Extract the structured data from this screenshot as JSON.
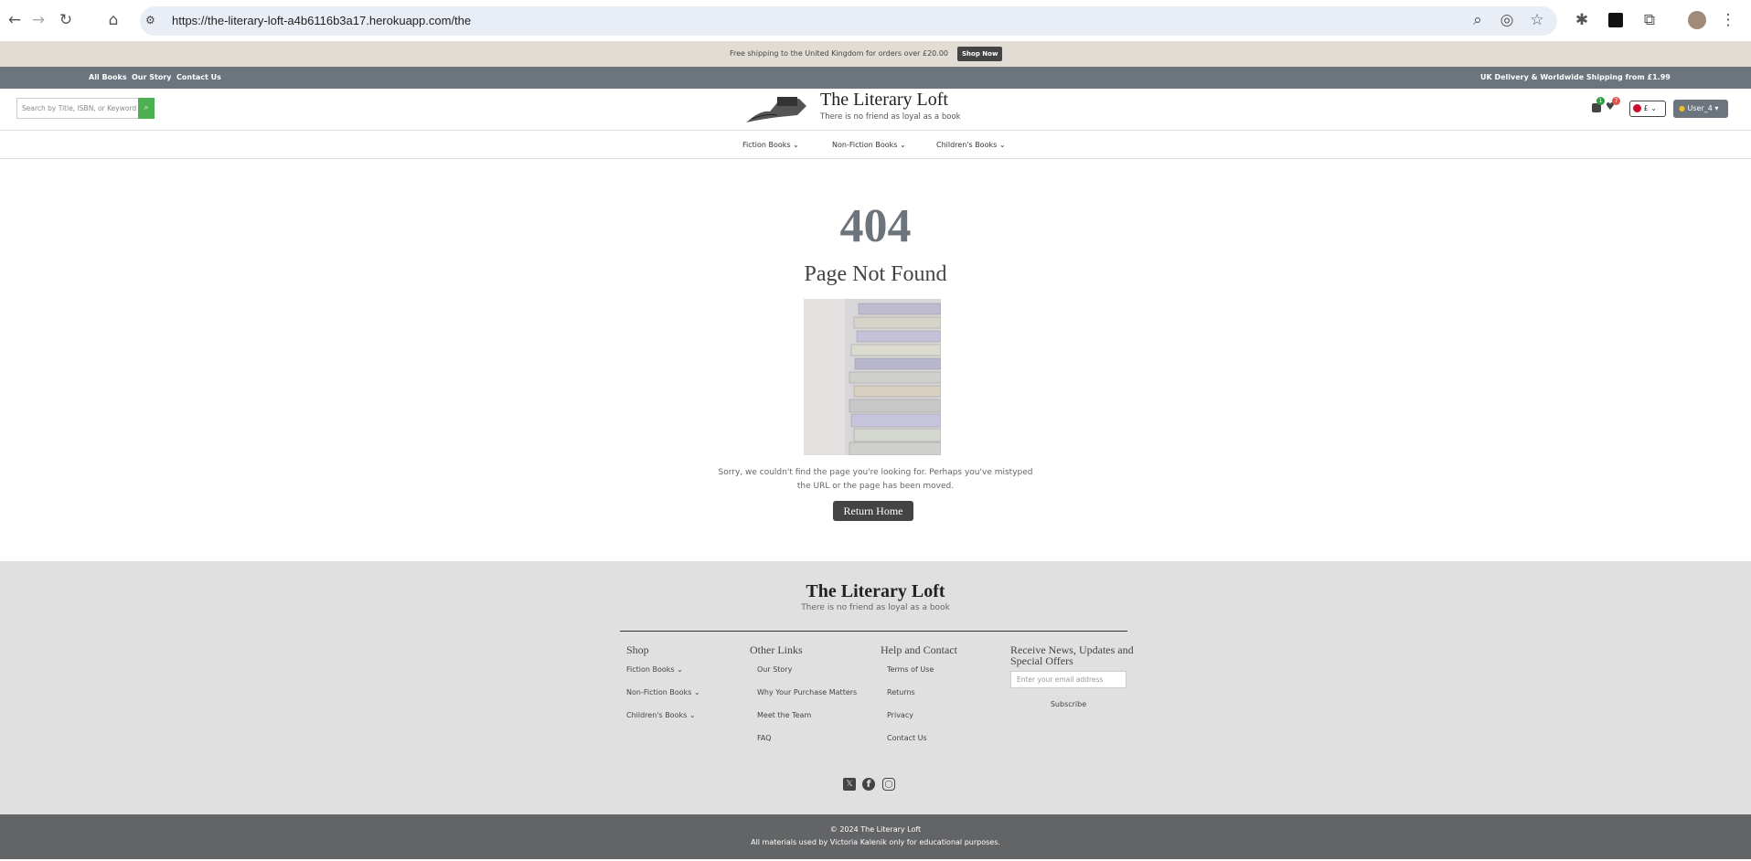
{
  "browser": {
    "url": "https://the-literary-loft-a4b6116b3a17.herokuapp.com/the",
    "icons": [
      "back-icon",
      "forward-icon",
      "reload-icon",
      "home-icon",
      "site-info-icon",
      "zoom-icon",
      "eye-off-icon",
      "star-icon",
      "bug-icon",
      "extension-icon",
      "puzzle-icon",
      "profile-avatar",
      "menu-icon"
    ]
  },
  "promo": {
    "text": "Free shipping to the United Kingdom for orders over £20.00",
    "button": "Shop Now"
  },
  "topnav": {
    "links": [
      "All Books",
      "Our Story",
      "Contact Us"
    ],
    "shipping": "UK Delivery & Worldwide Shipping from £1.99"
  },
  "header": {
    "search_placeholder": "Search by Title, ISBN, or Keyword",
    "title": "The Literary Loft",
    "tagline": "There is no friend as loyal as a book",
    "cart_count": "1",
    "wishlist_count": "7",
    "currency": "£",
    "user": "User_4"
  },
  "categories": [
    "Fiction Books",
    "Non-Fiction Books",
    "Children's Books"
  ],
  "main": {
    "code": "404",
    "heading": "Page Not Found",
    "message": "Sorry, we couldn't find the page you're looking for. Perhaps you've mistyped the URL or the page has been moved.",
    "button": "Return Home"
  },
  "footer": {
    "title": "The Literary Loft",
    "tagline": "There is no friend as loyal as a book",
    "shop": {
      "heading": "Shop",
      "links": [
        "Fiction Books",
        "Non-Fiction Books",
        "Children's Books"
      ]
    },
    "other": {
      "heading": "Other Links",
      "links": [
        "Our Story",
        "Why Your Purchase Matters",
        "Meet the Team",
        "FAQ"
      ]
    },
    "help": {
      "heading": "Help and Contact",
      "links": [
        "Terms of Use",
        "Returns",
        "Privacy",
        "Contact Us"
      ]
    },
    "newsletter": {
      "heading": "Receive News, Updates and Special Offers",
      "placeholder": "Enter your email address",
      "button": "Subscribe"
    },
    "social": [
      "x-icon",
      "facebook-icon",
      "instagram-icon"
    ],
    "copyright": "© 2024 The Literary Loft",
    "disclaimer": "All materials used by Victoria Kalenik only for educational purposes."
  },
  "colors": {
    "accent_green": "#4caf50",
    "nav_gray": "#6c757d",
    "footer_bg": "#e0e0e0",
    "bottom_bar": "#636466"
  }
}
